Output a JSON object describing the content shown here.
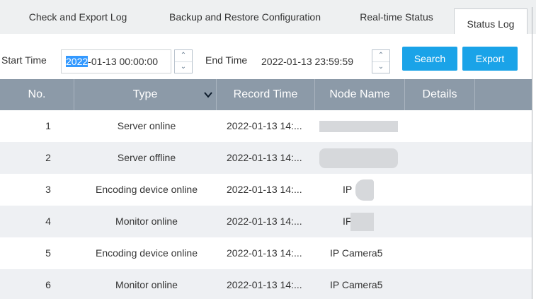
{
  "tabs": [
    {
      "label": "Check and Export Log",
      "active": false
    },
    {
      "label": "Backup and Restore Configuration",
      "active": false
    },
    {
      "label": "Real-time Status",
      "active": false
    },
    {
      "label": "Status Log",
      "active": true
    }
  ],
  "filter": {
    "start_label": "Start Time",
    "start_value_selected": "2022",
    "start_value_rest": "-01-13 00:00:00",
    "end_label": "End Time",
    "end_value": "2022-01-13 23:59:59",
    "search_label": "Search",
    "export_label": "Export"
  },
  "table": {
    "headers": [
      "No.",
      "Type",
      "Record Time",
      "Node Name",
      "Details"
    ],
    "rows": [
      {
        "no": "1",
        "type": "Server online",
        "time": "2022-01-13 14:...",
        "node": ""
      },
      {
        "no": "2",
        "type": "Server offline",
        "time": "2022-01-13 14:...",
        "node": ""
      },
      {
        "no": "3",
        "type": "Encoding device online",
        "time": "2022-01-13 14:...",
        "node": "IP"
      },
      {
        "no": "4",
        "type": "Monitor online",
        "time": "2022-01-13 14:...",
        "node": "IF"
      },
      {
        "no": "5",
        "type": "Encoding device online",
        "time": "2022-01-13 14:...",
        "node": "IP Camera5"
      },
      {
        "no": "6",
        "type": "Monitor online",
        "time": "2022-01-13 14:...",
        "node": "IP Camera5"
      }
    ]
  },
  "colors": {
    "accent": "#1aa3e8",
    "header_bg": "#8c9aa8",
    "row_alt": "#eef0f3",
    "selection": "#3399ff"
  }
}
